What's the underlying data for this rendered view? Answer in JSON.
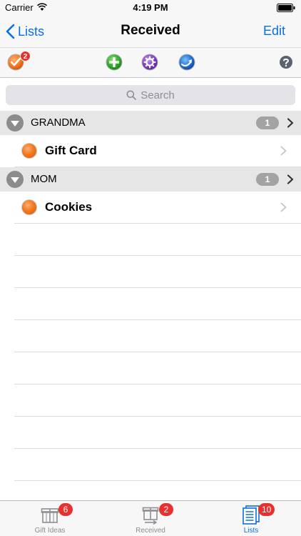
{
  "status_bar": {
    "carrier": "Carrier",
    "time": "4:19 PM"
  },
  "nav": {
    "back_label": "Lists",
    "title": "Received",
    "edit_label": "Edit"
  },
  "toolbar": {
    "checklist_badge": "2",
    "icons": [
      "checklist-icon",
      "add-icon",
      "settings-icon",
      "sync-icon",
      "help-icon"
    ]
  },
  "search": {
    "placeholder": "Search"
  },
  "sections": [
    {
      "title": "GRANDMA",
      "count": "1",
      "items": [
        {
          "label": "Gift Card"
        }
      ]
    },
    {
      "title": "MOM",
      "count": "1",
      "items": [
        {
          "label": "Cookies"
        }
      ]
    }
  ],
  "tabs": [
    {
      "label": "Gift Ideas",
      "badge": "6",
      "active": false
    },
    {
      "label": "Received",
      "badge": "2",
      "active": false
    },
    {
      "label": "Lists",
      "badge": "10",
      "active": true
    }
  ],
  "colors": {
    "accent": "#0a6ee0",
    "badge": "#e8302f",
    "item_dot": "#f47920"
  }
}
